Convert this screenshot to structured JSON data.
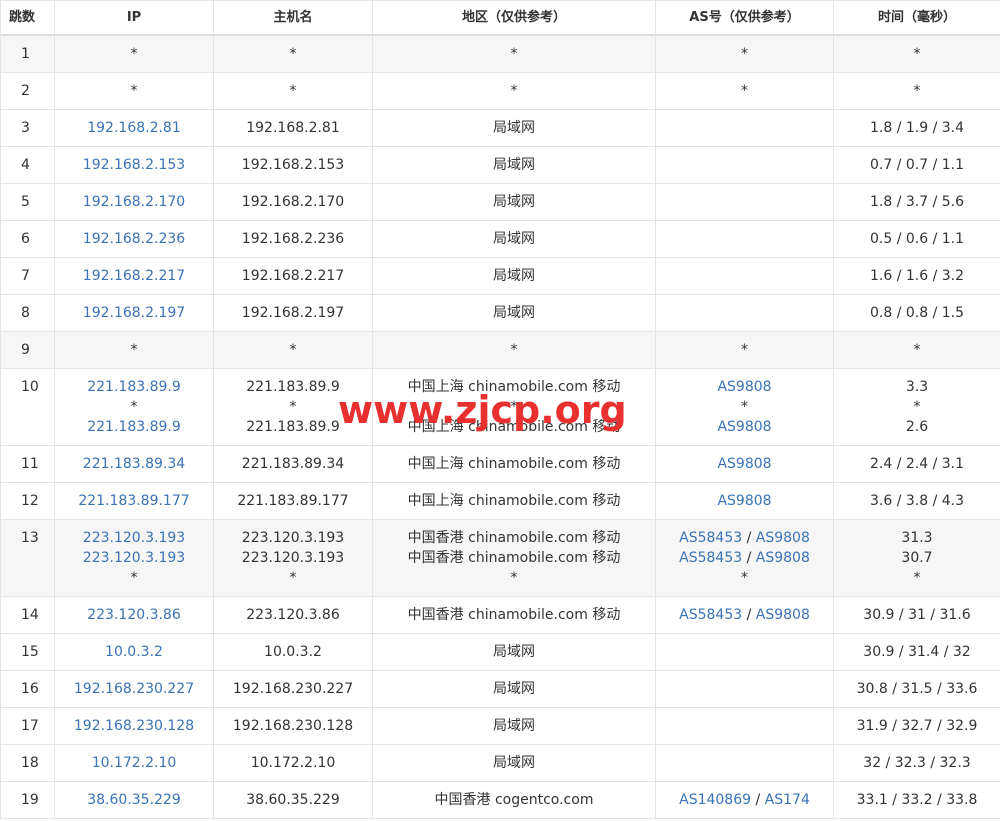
{
  "headers": {
    "hop": "跳数",
    "ip": "IP",
    "host": "主机名",
    "region": "地区（仅供参考）",
    "as": "AS号（仅供参考）",
    "time": "时间（毫秒）"
  },
  "colors": {
    "link": "#3a73b6",
    "watermark": "#e8302f",
    "shaded_row": "#f6f6f6"
  },
  "watermark": "www.zjcp.org",
  "rows": [
    {
      "hop": "1",
      "shaded": true,
      "lines": [
        {
          "ip": "*",
          "host": "*",
          "region": "*",
          "as": [
            "*"
          ],
          "time": "*"
        }
      ]
    },
    {
      "hop": "2",
      "shaded": false,
      "lines": [
        {
          "ip": "*",
          "host": "*",
          "region": "*",
          "as": [
            "*"
          ],
          "time": "*"
        }
      ]
    },
    {
      "hop": "3",
      "shaded": false,
      "lines": [
        {
          "ip": "192.168.2.81",
          "host": "192.168.2.81",
          "region": "局域网",
          "as": [],
          "time": "1.8 / 1.9 / 3.4"
        }
      ]
    },
    {
      "hop": "4",
      "shaded": false,
      "lines": [
        {
          "ip": "192.168.2.153",
          "host": "192.168.2.153",
          "region": "局域网",
          "as": [],
          "time": "0.7 / 0.7 / 1.1"
        }
      ]
    },
    {
      "hop": "5",
      "shaded": false,
      "lines": [
        {
          "ip": "192.168.2.170",
          "host": "192.168.2.170",
          "region": "局域网",
          "as": [],
          "time": "1.8 / 3.7 / 5.6"
        }
      ]
    },
    {
      "hop": "6",
      "shaded": false,
      "lines": [
        {
          "ip": "192.168.2.236",
          "host": "192.168.2.236",
          "region": "局域网",
          "as": [],
          "time": "0.5 / 0.6 / 1.1"
        }
      ]
    },
    {
      "hop": "7",
      "shaded": false,
      "lines": [
        {
          "ip": "192.168.2.217",
          "host": "192.168.2.217",
          "region": "局域网",
          "as": [],
          "time": "1.6 / 1.6 / 3.2"
        }
      ]
    },
    {
      "hop": "8",
      "shaded": false,
      "lines": [
        {
          "ip": "192.168.2.197",
          "host": "192.168.2.197",
          "region": "局域网",
          "as": [],
          "time": "0.8 / 0.8 / 1.5"
        }
      ]
    },
    {
      "hop": "9",
      "shaded": true,
      "lines": [
        {
          "ip": "*",
          "host": "*",
          "region": "*",
          "as": [
            "*"
          ],
          "time": "*"
        }
      ]
    },
    {
      "hop": "10",
      "shaded": false,
      "lines": [
        {
          "ip": "221.183.89.9",
          "host": "221.183.89.9",
          "region": "中国上海 chinamobile.com 移动",
          "as": [
            "AS9808"
          ],
          "time": "3.3"
        },
        {
          "ip": "*",
          "host": "*",
          "region": "*",
          "as": [
            "*"
          ],
          "time": "*"
        },
        {
          "ip": "221.183.89.9",
          "host": "221.183.89.9",
          "region": "中国上海 chinamobile.com 移动",
          "as": [
            "AS9808"
          ],
          "time": "2.6"
        }
      ]
    },
    {
      "hop": "11",
      "shaded": false,
      "lines": [
        {
          "ip": "221.183.89.34",
          "host": "221.183.89.34",
          "region": "中国上海 chinamobile.com 移动",
          "as": [
            "AS9808"
          ],
          "time": "2.4 / 2.4 / 3.1"
        }
      ]
    },
    {
      "hop": "12",
      "shaded": false,
      "lines": [
        {
          "ip": "221.183.89.177",
          "host": "221.183.89.177",
          "region": "中国上海 chinamobile.com 移动",
          "as": [
            "AS9808"
          ],
          "time": "3.6 / 3.8 / 4.3"
        }
      ]
    },
    {
      "hop": "13",
      "shaded": true,
      "lines": [
        {
          "ip": "223.120.3.193",
          "host": "223.120.3.193",
          "region": "中国香港 chinamobile.com 移动",
          "as": [
            "AS58453",
            "AS9808"
          ],
          "time": "31.3"
        },
        {
          "ip": "223.120.3.193",
          "host": "223.120.3.193",
          "region": "中国香港 chinamobile.com 移动",
          "as": [
            "AS58453",
            "AS9808"
          ],
          "time": "30.7"
        },
        {
          "ip": "*",
          "host": "*",
          "region": "*",
          "as": [
            "*"
          ],
          "time": "*"
        }
      ]
    },
    {
      "hop": "14",
      "shaded": false,
      "lines": [
        {
          "ip": "223.120.3.86",
          "host": "223.120.3.86",
          "region": "中国香港 chinamobile.com 移动",
          "as": [
            "AS58453",
            "AS9808"
          ],
          "time": "30.9 / 31 / 31.6"
        }
      ]
    },
    {
      "hop": "15",
      "shaded": false,
      "lines": [
        {
          "ip": "10.0.3.2",
          "host": "10.0.3.2",
          "region": "局域网",
          "as": [],
          "time": "30.9 / 31.4 / 32"
        }
      ]
    },
    {
      "hop": "16",
      "shaded": false,
      "lines": [
        {
          "ip": "192.168.230.227",
          "host": "192.168.230.227",
          "region": "局域网",
          "as": [],
          "time": "30.8 / 31.5 / 33.6"
        }
      ]
    },
    {
      "hop": "17",
      "shaded": false,
      "lines": [
        {
          "ip": "192.168.230.128",
          "host": "192.168.230.128",
          "region": "局域网",
          "as": [],
          "time": "31.9 / 32.7 / 32.9"
        }
      ]
    },
    {
      "hop": "18",
      "shaded": false,
      "lines": [
        {
          "ip": "10.172.2.10",
          "host": "10.172.2.10",
          "region": "局域网",
          "as": [],
          "time": "32 / 32.3 / 32.3"
        }
      ]
    },
    {
      "hop": "19",
      "shaded": false,
      "lines": [
        {
          "ip": "38.60.35.229",
          "host": "38.60.35.229",
          "region": "中国香港 cogentco.com",
          "as": [
            "AS140869",
            "AS174"
          ],
          "time": "33.1 / 33.2 / 33.8"
        }
      ]
    }
  ]
}
